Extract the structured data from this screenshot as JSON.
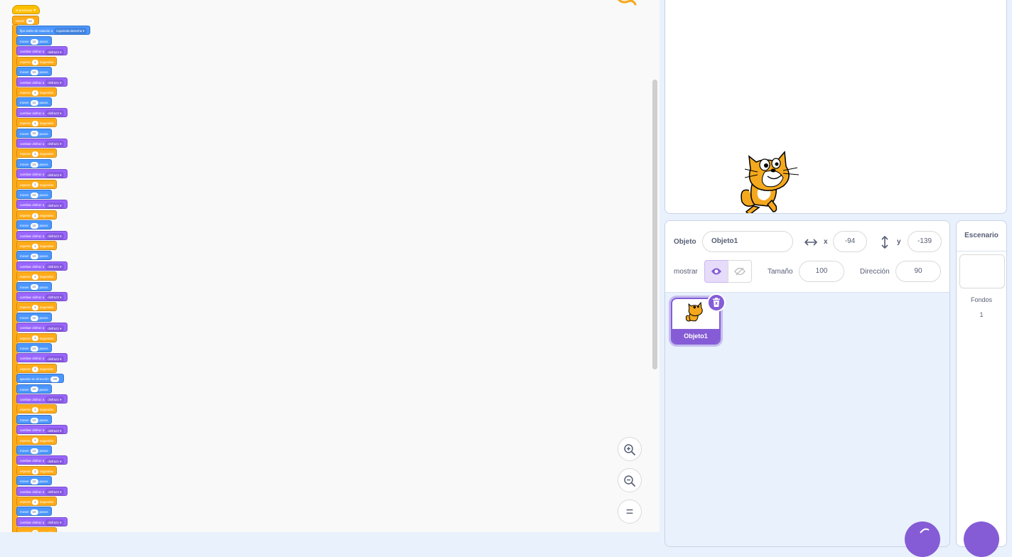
{
  "script": {
    "hat_label": "al presionar",
    "repeat_label": "repetir",
    "repeat_count": "10",
    "rotation_label": "fijar estilo de rotación a",
    "rotation_value": "izquierda-derecha",
    "move_label": "mover",
    "move_value": "10",
    "move_suffix": "pasos",
    "costume_label": "cambiar disfraz a",
    "costume1": "disfraz1",
    "costume2": "disfraz2",
    "wait_label": "esperar",
    "wait_value": "1",
    "wait_suffix": "segundos",
    "point_label": "apuntar en dirección",
    "point_value": "-90"
  },
  "zoom": {
    "in_label": "+",
    "out_label": "−",
    "reset_label": "="
  },
  "sprite_info": {
    "object_label": "Objeto",
    "object_name": "Objeto1",
    "x_label": "x",
    "x_value": "-94",
    "y_label": "y",
    "y_value": "-139",
    "show_label": "mostrar",
    "size_label": "Tamaño",
    "size_value": "100",
    "direction_label": "Dirección",
    "direction_value": "90"
  },
  "sprite_list": {
    "items": [
      {
        "name": "Objeto1"
      }
    ]
  },
  "stage_pane": {
    "title": "Escenario",
    "backdrops_label": "Fondos",
    "backdrops_count": "1"
  },
  "colors": {
    "motion": "#4c97ff",
    "looks": "#9966ff",
    "control": "#ffab19",
    "events": "#ffbf00",
    "accent": "#855cd6"
  }
}
